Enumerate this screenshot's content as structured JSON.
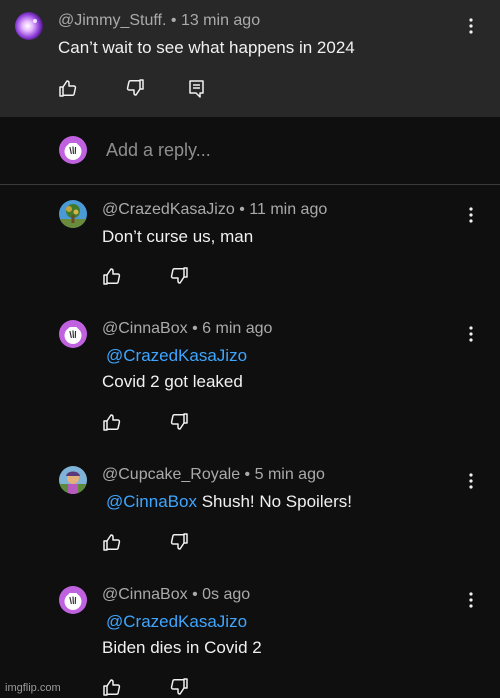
{
  "top_comment": {
    "author": "@Jimmy_Stuff.",
    "separator": "•",
    "time": "13 min ago",
    "text": "Can’t wait to see what happens in 2024",
    "avatar_icon": "galaxy-avatar-icon",
    "actions": [
      "like-icon",
      "dislike-icon",
      "reply-icon"
    ]
  },
  "reply_box": {
    "placeholder": "Add a reply...",
    "avatar_icon": "cinnabox-avatar-icon"
  },
  "replies": [
    {
      "author": "@CrazedKasaJizo",
      "separator": "•",
      "time": "11 min ago",
      "mention": "",
      "text": "Don’t curse us, man",
      "avatar_icon": "tree-avatar-icon"
    },
    {
      "author": "@CinnaBox",
      "separator": "•",
      "time": "6 min ago",
      "mention": "@CrazedKasaJizo",
      "text": "Covid 2 got leaked",
      "avatar_icon": "cinnabox-avatar-icon"
    },
    {
      "author": "@Cupcake_Royale",
      "separator": "•",
      "time": "5 min ago",
      "mention": "@CinnaBox",
      "text": "Shush! No Spoilers!",
      "avatar_icon": "cupcake-avatar-icon"
    },
    {
      "author": "@CinnaBox",
      "separator": "•",
      "time": "0s ago",
      "mention": "@CrazedKasaJizo",
      "text": "Biden dies in Covid 2",
      "avatar_icon": "cinnabox-avatar-icon"
    }
  ],
  "watermark": "imgflip.com",
  "colors": {
    "background": "#0f0f0f",
    "highlight_background": "#282828",
    "mention": "#3ea6ff",
    "meta_text": "#aaaaaa",
    "primary_text": "#f1f1f1"
  }
}
